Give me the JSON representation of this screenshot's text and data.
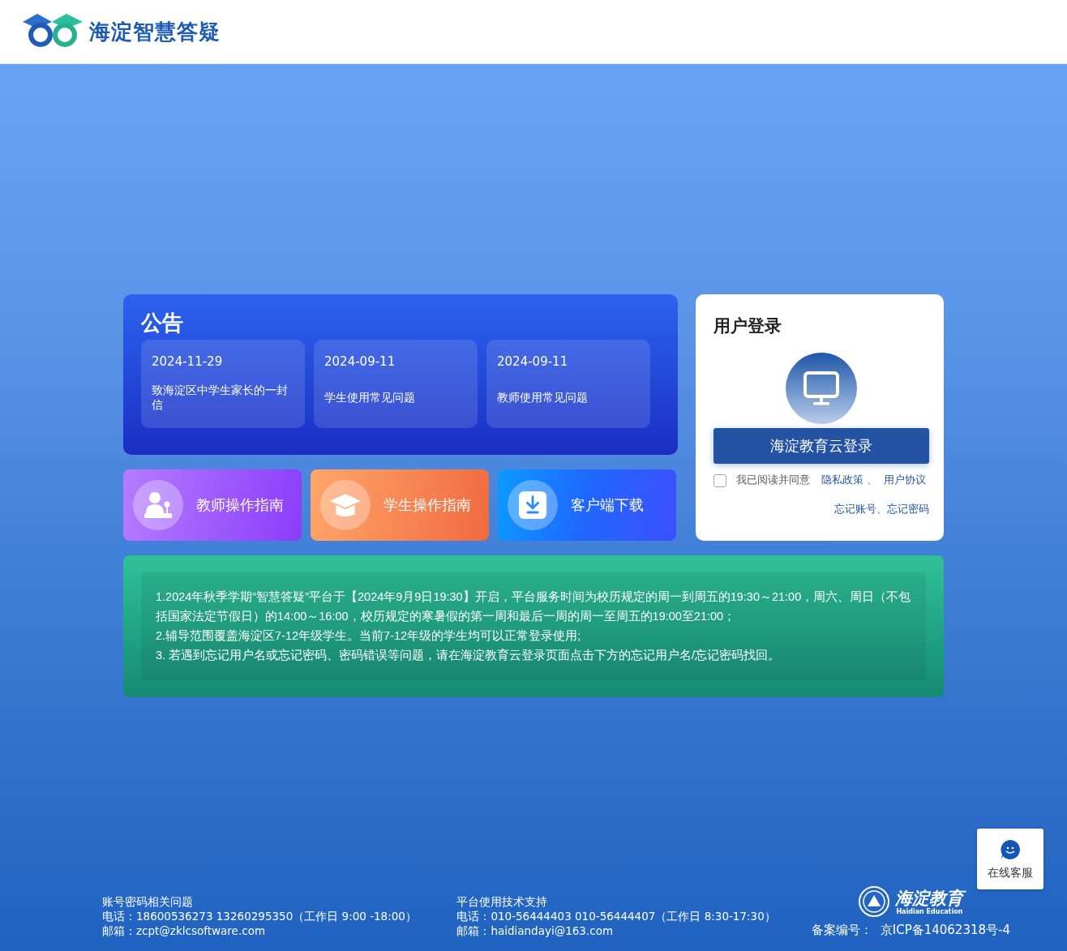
{
  "header": {
    "logo_text": "海淀智慧答疑"
  },
  "notice": {
    "title": "公告",
    "items": [
      {
        "date": "2024-11-29",
        "title": "致海淀区中学生家长的一封信"
      },
      {
        "date": "2024-09-11",
        "title": "学生使用常见问题"
      },
      {
        "date": "2024-09-11",
        "title": "教师使用常见问题"
      }
    ]
  },
  "quick_links": [
    {
      "kind": "teacher",
      "label": "教师操作指南"
    },
    {
      "kind": "student",
      "label": "学生操作指南"
    },
    {
      "kind": "download",
      "label": "客户端下载"
    }
  ],
  "login": {
    "title": "用户登录",
    "button": "海淀教育云登录",
    "agree_checked": false,
    "agree_text": "我已阅读并同意",
    "links": [
      "隐私政策",
      "用户协议"
    ],
    "separator": "、",
    "forgot": "忘记账号、忘记密码"
  },
  "info": [
    "1.2024年秋季学期“智慧答疑”平台于【2024年9月9日19:30】开启，平台服务时间为校历规定的周一到周五的19:30～21:00，周六、周日（不包括国家法定节假日）的14:00～16:00，校历规定的寒暑假的第一周和最后一周的周一至周五的19:00至21:00；",
    "2.辅导范围覆盖海淀区7-12年级学生。当前7-12年级的学生均可以正常登录使用;",
    "3. 若遇到忘记用户名或忘记密码、密码错误等问题，请在海淀教育云登录页面点击下方的忘记用户名/忘记密码找回。"
  ],
  "footer": {
    "contacts": [
      {
        "title": "账号密码相关问题",
        "lines": [
          "电话：18600536273 13260295350（工作日 9:00 -18:00）",
          "邮箱：zcpt@zklcsoftware.com"
        ]
      },
      {
        "title": "平台使用技术支持",
        "lines": [
          "电话：010-56444403 010-56444407（工作日 8:30-17:30）",
          "邮箱：haidiandayi@163.com"
        ]
      }
    ],
    "service": "在线客服",
    "edu_logo": {
      "name": "海淀教育",
      "subtitle": "Haidian Education"
    },
    "icp_label": "备案编号：",
    "icp_value": "京ICP备14062318号-4"
  }
}
